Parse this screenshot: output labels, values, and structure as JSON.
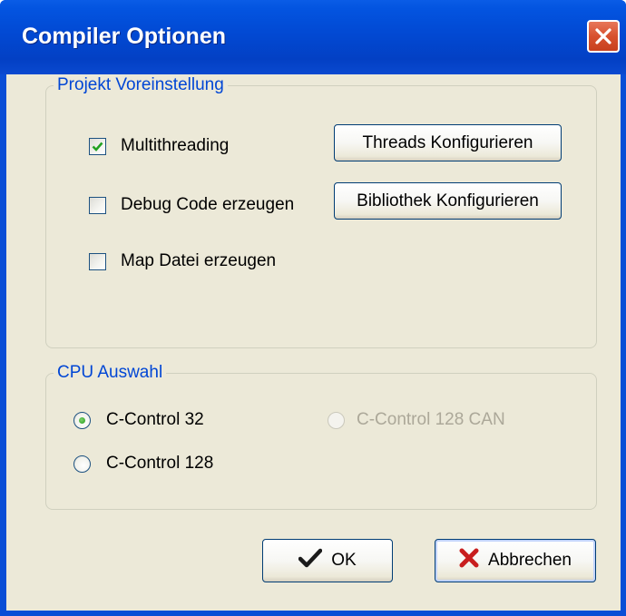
{
  "window": {
    "title": "Compiler Optionen"
  },
  "project_group": {
    "legend": "Projekt Voreinstellung",
    "options": [
      {
        "label": "Multithreading",
        "checked": true
      },
      {
        "label": "Debug Code erzeugen",
        "checked": false
      },
      {
        "label": "Map Datei erzeugen",
        "checked": false
      }
    ],
    "threads_button": "Threads Konfigurieren",
    "library_button": "Bibliothek Konfigurieren"
  },
  "cpu_group": {
    "legend": "CPU Auswahl",
    "options": [
      {
        "label": "C-Control 32",
        "selected": true,
        "enabled": true
      },
      {
        "label": "C-Control 128",
        "selected": false,
        "enabled": true
      },
      {
        "label": "C-Control 128 CAN",
        "selected": false,
        "enabled": false
      }
    ]
  },
  "buttons": {
    "ok_label": "OK",
    "cancel_label": "Abbrechen"
  },
  "icons": {
    "close": "close-icon",
    "ok": "checkmark-icon",
    "cancel": "red-x-icon"
  },
  "colors": {
    "titlebar": "#0354e0",
    "legend_text": "#0046d5",
    "dialog_bg": "#ece9d8",
    "radio_dot": "#219a1c",
    "cancel_x": "#c81e1e"
  }
}
